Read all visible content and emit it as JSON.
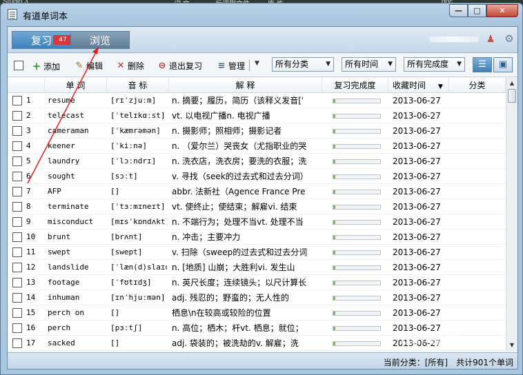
{
  "desktop": {
    "items": [
      "Studio 3",
      "词 文",
      "后调删文件",
      "库 炸",
      "doc"
    ]
  },
  "window": {
    "title": "有道单词本",
    "controls": {
      "minimize": "—",
      "maximize": "□",
      "close": "✕"
    }
  },
  "tabs": {
    "review_label": "复习",
    "review_badge": "47",
    "browse_label": "浏览"
  },
  "header_icons": {
    "user": "user-icon",
    "settings": "gear-icon"
  },
  "toolbar": {
    "add": "添加",
    "edit": "编辑",
    "delete": "删除",
    "quit_review": "退出复习",
    "manage": "管理",
    "filter_category": "所有分类",
    "filter_time": "所有时间",
    "filter_completion": "所有完成度"
  },
  "columns": {
    "word": "单 词",
    "phonetic": "音 标",
    "definition": "解 释",
    "progress": "复习完成度",
    "date": "收藏时间",
    "category": "分类"
  },
  "rows": [
    {
      "n": "1",
      "word": "resume",
      "phon": "[rɪˈzjuːm]",
      "def": "n. 摘要；履历，简历（该释义发音[ˈ",
      "prog": 0.04,
      "date": "2013-06-27"
    },
    {
      "n": "2",
      "word": "telecast",
      "phon": "[ˈtelɪkɑːst]",
      "def": "vt. 以电视广播n. 电视广播",
      "prog": 0.04,
      "date": "2013-06-27"
    },
    {
      "n": "3",
      "word": "cameraman",
      "phon": "[ˈkæmrəmən]",
      "def": "n. 摄影师；照相师；摄影记者",
      "prog": 0.04,
      "date": "2013-06-27"
    },
    {
      "n": "4",
      "word": "keener",
      "phon": "[ˈkiːnə]",
      "def": "n. （爱尔兰）哭丧女（尤指职业的哭",
      "prog": 0.04,
      "date": "2013-06-27"
    },
    {
      "n": "5",
      "word": "laundry",
      "phon": "[ˈlɔːndrɪ]",
      "def": "n. 洗衣店，洗衣房；要洗的衣服；洗",
      "prog": 0.04,
      "date": "2013-06-27"
    },
    {
      "n": "6",
      "word": "sought",
      "phon": "[sɔːt]",
      "def": "v. 寻找（seek的过去式和过去分词）",
      "prog": 0.04,
      "date": "2013-06-27"
    },
    {
      "n": "7",
      "word": "AFP",
      "phon": "[]",
      "def": "abbr. 法新社（Agence France Pre",
      "prog": 0.04,
      "date": "2013-06-27"
    },
    {
      "n": "8",
      "word": "terminate",
      "phon": "[ˈtɜːmɪneɪt]",
      "def": "vt. 使终止；使结束；解雇vi. 结束",
      "prog": 0.04,
      "date": "2013-06-27"
    },
    {
      "n": "9",
      "word": "misconduct",
      "phon": "[mɪsˈkɒndʌkt]",
      "def": "n. 不端行为；处理不当vt. 处理不当",
      "prog": 0.04,
      "date": "2013-06-27"
    },
    {
      "n": "10",
      "word": "brunt",
      "phon": "[brʌnt]",
      "def": "n. 冲击；主要冲力",
      "prog": 0.04,
      "date": "2013-06-27"
    },
    {
      "n": "11",
      "word": "swept",
      "phon": "[swept]",
      "def": "v. 扫除（sweep的过去式和过去分词",
      "prog": 0.04,
      "date": "2013-06-27"
    },
    {
      "n": "12",
      "word": "landslide",
      "phon": "[ˈlæn(d)slaɪd",
      "def": "n. [地质] 山崩；大胜利vi. 发生山",
      "prog": 0.04,
      "date": "2013-06-27"
    },
    {
      "n": "13",
      "word": "footage",
      "phon": "[ˈfʊtɪdʒ]",
      "def": "n. 英尺长度；连续镜头；以尺计算长",
      "prog": 0.04,
      "date": "2013-06-27"
    },
    {
      "n": "14",
      "word": "inhuman",
      "phon": "[ɪnˈhjuːmən]",
      "def": "adj. 残忍的；野蛮的；无人性的",
      "prog": 0.04,
      "date": "2013-06-27"
    },
    {
      "n": "15",
      "word": "perch on",
      "phon": "[]",
      "def": "栖息\\n在较高或较险的位置",
      "prog": 0.04,
      "date": "2013-06-27"
    },
    {
      "n": "16",
      "word": "perch",
      "phon": "[pɜːtʃ]",
      "def": "n. 高位；栖木；杆vt. 栖息；就位；",
      "prog": 0.04,
      "date": "2013-06-27"
    },
    {
      "n": "17",
      "word": "sacked",
      "phon": "[]",
      "def": "adj. 袋装的；被洗劫的v. 解雇；洗",
      "prog": 0.04,
      "date": "2013-06-27"
    }
  ],
  "status": {
    "text": "当前分类：[所有]　共计901个单词"
  },
  "watermark": "Bai 经验"
}
